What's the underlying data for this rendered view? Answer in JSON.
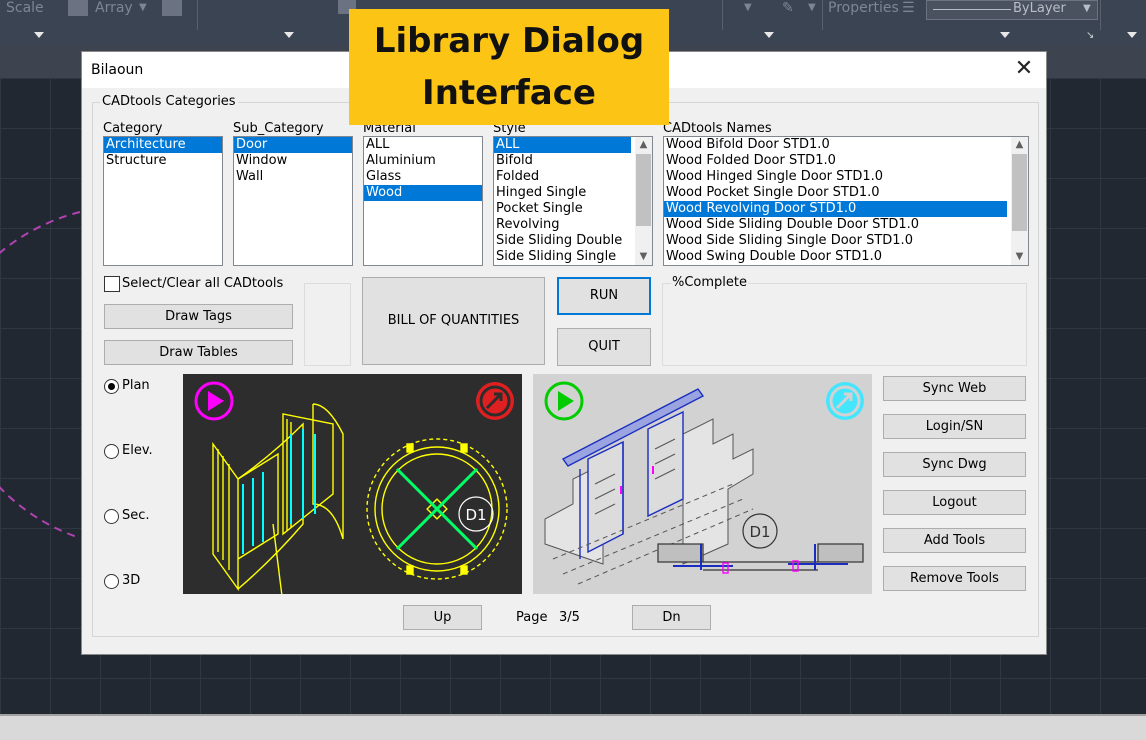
{
  "ribbon": {
    "scale_label": "Scale",
    "array_label": "Array",
    "properties_label": "Properties",
    "bylayer_value": "ByLayer"
  },
  "banner": {
    "line1": "Library Dialog",
    "line2": "Interface"
  },
  "dialog": {
    "title": "Bilaoun",
    "close_glyph": "✕",
    "group_title": "CADtools Categories",
    "category": {
      "label": "Category",
      "items": [
        "Architecture",
        "Structure"
      ],
      "selected": "Architecture"
    },
    "sub_category": {
      "label": "Sub_Category",
      "items": [
        "Door",
        "Window",
        "Wall"
      ],
      "selected": "Door"
    },
    "material": {
      "label": "Material",
      "items": [
        "ALL",
        "Aluminium",
        "Glass",
        "Wood"
      ],
      "selected": "Wood"
    },
    "style": {
      "label": "Style",
      "items": [
        "ALL",
        "Bifold",
        "Folded",
        "Hinged Single",
        "Pocket Single",
        "Revolving",
        "Side Sliding Double",
        "Side Sliding Single"
      ],
      "selected": "ALL"
    },
    "names": {
      "label": "CADtools Names",
      "items": [
        "Wood Bifold Door STD1.0",
        "Wood Folded Door STD1.0",
        "Wood Hinged Single Door STD1.0",
        "Wood Pocket Single Door STD1.0",
        "Wood Revolving Door STD1.0",
        "Wood Side Sliding Double Door STD1.0",
        "Wood Side Sliding Single Door STD1.0",
        "Wood Swing Double Door STD1.0"
      ],
      "selected": "Wood Revolving Door STD1.0"
    },
    "select_all_label": "Select/Clear all CADtools",
    "draw_tags_label": "Draw Tags",
    "draw_tables_label": "Draw Tables",
    "boq_label": "BILL OF QUANTITIES",
    "run_label": "RUN",
    "quit_label": "QUIT",
    "percent_label": "%Complete",
    "views": {
      "plan": "Plan",
      "elev": "Elev.",
      "sec": "Sec.",
      "three_d": "3D",
      "selected": "Plan"
    },
    "side_buttons": {
      "sync_web": "Sync Web",
      "login": "Login/SN",
      "sync_dwg": "Sync Dwg",
      "logout": "Logout",
      "add_tools": "Add Tools",
      "remove_tools": "Remove Tools"
    },
    "pager": {
      "up_label": "Up",
      "page_label": "Page",
      "page_value": "3/5",
      "dn_label": "Dn"
    },
    "preview_tags": [
      "D1",
      "D1"
    ],
    "colors": {
      "selection": "#0078d7",
      "cad_yellow": "#ffff00",
      "cad_cyan": "#00ffff",
      "banner": "#fcc516"
    }
  }
}
